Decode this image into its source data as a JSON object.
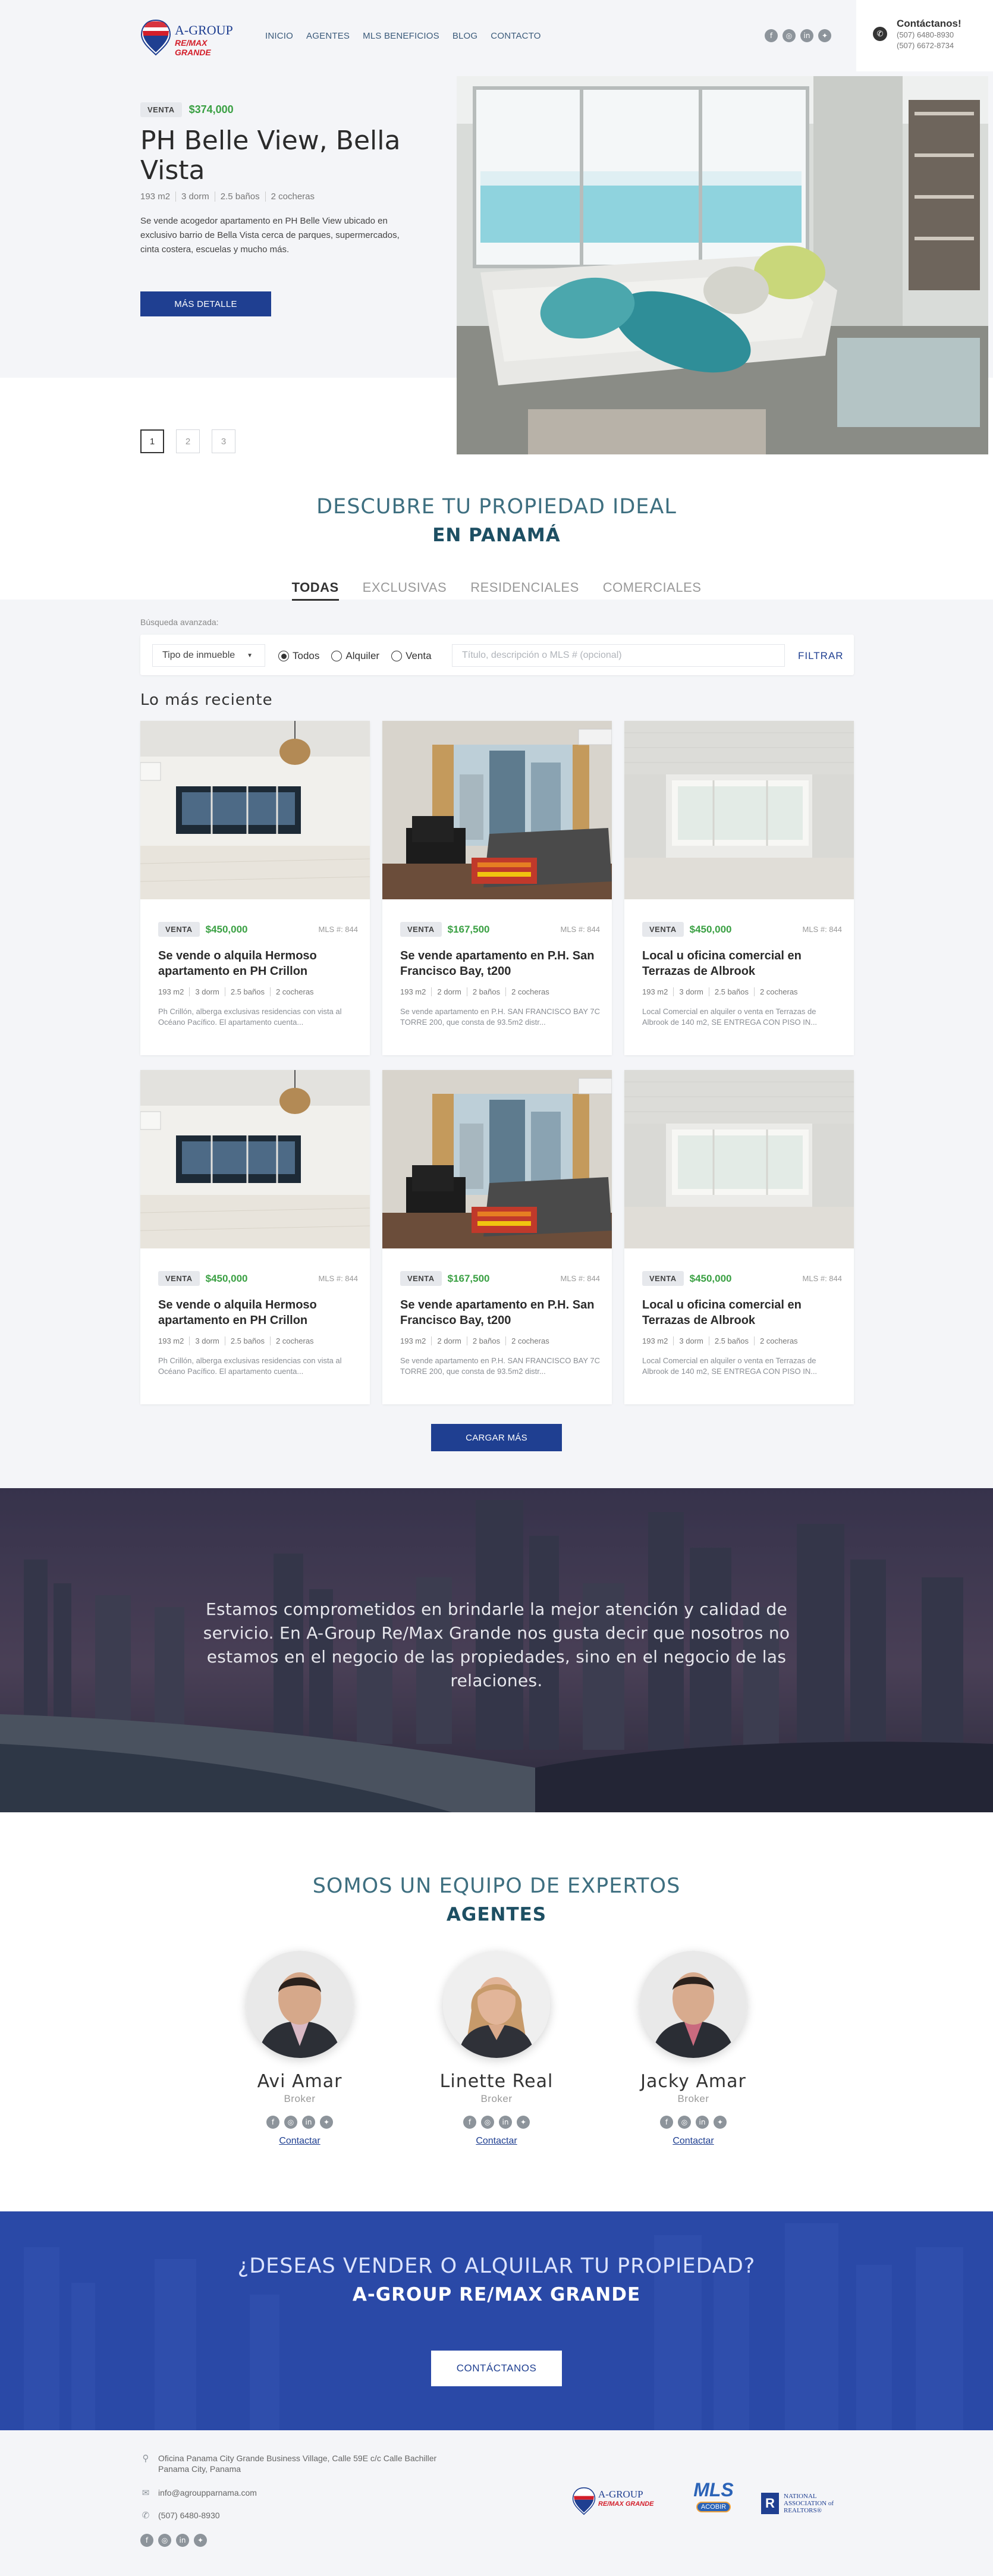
{
  "brand": {
    "name": "A-GROUP",
    "sub": "RE/MAX GRANDE",
    "colors": {
      "primary": "#1f3f91",
      "accent": "#d31e2a",
      "price": "#3aa043"
    }
  },
  "nav": [
    "INICIO",
    "AGENTES",
    "MLS BENEFICIOS",
    "BLOG",
    "CONTACTO"
  ],
  "header_contact": {
    "title": "Contáctanos!",
    "phone1": "(507) 6480-8930",
    "phone2": "(507) 6672-8734"
  },
  "social_icons": [
    "facebook-icon",
    "instagram-icon",
    "linkedin-icon",
    "twitter-icon"
  ],
  "hero": {
    "badge": "VENTA",
    "price": "$374,000",
    "title": "PH Belle View, Bella Vista",
    "specs": [
      "193 m2",
      "3 dorm",
      "2.5 baños",
      "2 cocheras"
    ],
    "description": "Se vende acogedor apartamento en PH Belle View ubicado en exclusivo barrio de Bella Vista cerca de parques, supermercados, cinta costera, escuelas y mucho más.",
    "button": "MÁS DETALLE",
    "pages": [
      "1",
      "2",
      "3"
    ]
  },
  "discover": {
    "subtitle": "DESCUBRE TU PROPIEDAD IDEAL",
    "title": "EN PANAMÁ",
    "tabs": [
      "TODAS",
      "EXCLUSIVAS",
      "RESIDENCIALES",
      "COMERCIALES"
    ],
    "active_tab": "TODAS"
  },
  "search": {
    "label": "Búsqueda avanzada:",
    "type_select": "Tipo de inmueble",
    "radios": [
      "Todos",
      "Alquiler",
      "Venta"
    ],
    "selected_radio": "Todos",
    "placeholder": "Título, descripción o MLS # (opcional)",
    "filter": "FILTRAR"
  },
  "recent": {
    "title": "Lo más reciente",
    "load_more": "CARGAR MÁS",
    "cards": [
      {
        "badge": "VENTA",
        "price": "$450,000",
        "mls": "MLS #: 844",
        "title": "Se vende o alquila Hermoso apartamento en PH Crillon",
        "specs": [
          "193 m2",
          "3 dorm",
          "2.5 baños",
          "2 cocheras"
        ],
        "desc": "Ph Crillón, alberga exclusivas residencias con vista al Océano Pacífico. El apartamento cuenta..."
      },
      {
        "badge": "VENTA",
        "price": "$167,500",
        "mls": "MLS #: 844",
        "title": "Se vende apartamento en P.H. San Francisco Bay, t200",
        "specs": [
          "193 m2",
          "2 dorm",
          "2 baños",
          "2 cocheras"
        ],
        "desc": "Se vende apartamento en P.H. SAN FRANCISCO BAY 7C TORRE 200, que consta de 93.5m2 distr..."
      },
      {
        "badge": "VENTA",
        "price": "$450,000",
        "mls": "MLS #: 844",
        "title": "Local u oficina comercial en Terrazas de Albrook",
        "specs": [
          "193 m2",
          "3 dorm",
          "2.5 baños",
          "2 cocheras"
        ],
        "desc": "Local Comercial en alquiler o venta en Terrazas de Albrook de 140 m2, SE ENTREGA CON PISO IN..."
      },
      {
        "badge": "VENTA",
        "price": "$450,000",
        "mls": "MLS #: 844",
        "title": "Se vende o alquila Hermoso apartamento en PH Crillon",
        "specs": [
          "193 m2",
          "3 dorm",
          "2.5 baños",
          "2 cocheras"
        ],
        "desc": "Ph Crillón, alberga exclusivas residencias con vista al Océano Pacífico. El apartamento cuenta..."
      },
      {
        "badge": "VENTA",
        "price": "$167,500",
        "mls": "MLS #: 844",
        "title": "Se vende apartamento en P.H. San Francisco Bay, t200",
        "specs": [
          "193 m2",
          "2 dorm",
          "2 baños",
          "2 cocheras"
        ],
        "desc": "Se vende apartamento en P.H. SAN FRANCISCO BAY 7C TORRE 200, que consta de 93.5m2 distr..."
      },
      {
        "badge": "VENTA",
        "price": "$450,000",
        "mls": "MLS #: 844",
        "title": "Local u oficina comercial en Terrazas de Albrook",
        "specs": [
          "193 m2",
          "3 dorm",
          "2.5 baños",
          "2 cocheras"
        ],
        "desc": "Local Comercial en alquiler o venta en Terrazas de Albrook de 140 m2, SE ENTREGA CON PISO IN..."
      }
    ]
  },
  "quote": "Estamos comprometidos en brindarle la mejor atención y calidad de servicio. En A-Group Re/Max Grande nos gusta decir que nosotros no estamos en el negocio de las propiedades, sino en el negocio de las relaciones.",
  "team": {
    "subtitle": "SOMOS UN EQUIPO DE EXPERTOS",
    "title": "AGENTES",
    "agents": [
      {
        "name": "Avi Amar",
        "role": "Broker",
        "link": "Contactar"
      },
      {
        "name": "Linette Real",
        "role": "Broker",
        "link": "Contactar"
      },
      {
        "name": "Jacky Amar",
        "role": "Broker",
        "link": "Contactar"
      }
    ]
  },
  "cta": {
    "subtitle": "¿DESEAS VENDER O ALQUILAR TU PROPIEDAD?",
    "title": "A-GROUP RE/MAX GRANDE",
    "button": "CONTÁCTANOS"
  },
  "footer": {
    "address1": "Oficina Panama City Grande Business Village, Calle 59E c/c Calle Bachiller",
    "address2": "Panama City, Panama",
    "email": "info@agroupparnama.com",
    "phone": "(507) 6480-8930",
    "partners": {
      "agroup": "A-GROUP",
      "agroup_sub": "RE/MAX GRANDE",
      "mls": "MLS",
      "mls_sub": "ACOBIR",
      "nar": "NATIONAL ASSOCIATION of REALTORS®"
    }
  }
}
